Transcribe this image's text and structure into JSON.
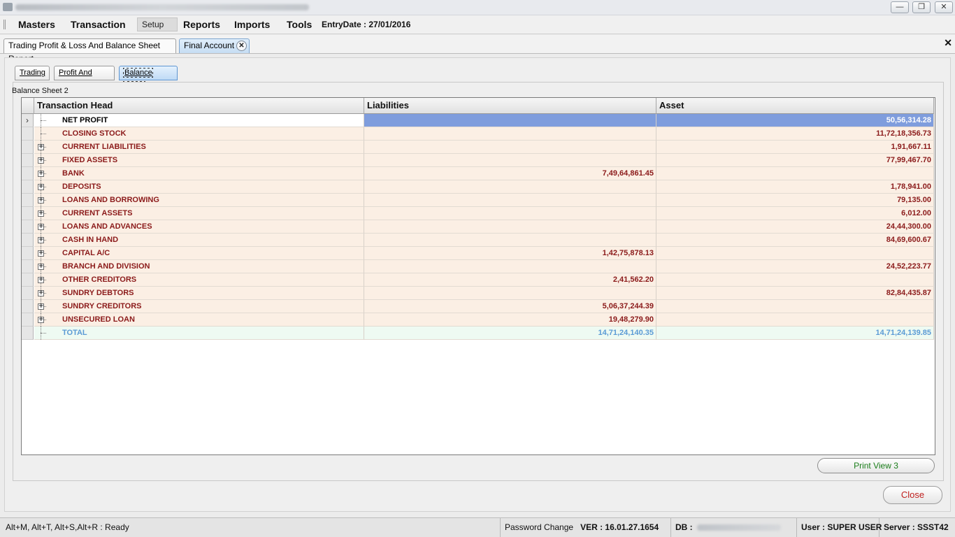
{
  "menu": {
    "items": [
      "Masters",
      "Transaction",
      "Setup",
      "Reports",
      "Imports",
      "Tools"
    ],
    "entry_date": "EntryDate : 27/01/2016"
  },
  "window_buttons": {
    "minimize": "—",
    "restore": "❐",
    "close": "✕"
  },
  "doc_tabs": {
    "tab1": "Trading Profit & Loss And Balance Sheet  Report",
    "tab2": "Final Account",
    "close_glyph": "✕"
  },
  "sub_tabs": [
    "Trading",
    "Profit And Loss",
    "Balance Sheet"
  ],
  "group_label": "Balance Sheet 2",
  "grid": {
    "columns": [
      "Transaction Head",
      "Liabilities",
      "Asset"
    ],
    "rows": [
      {
        "head": "NET PROFIT",
        "liabilities": "",
        "asset": "50,56,314.28"
      },
      {
        "head": "CLOSING STOCK",
        "liabilities": "",
        "asset": "11,72,18,356.73"
      },
      {
        "head": "CURRENT LIABILITIES",
        "liabilities": "",
        "asset": "1,91,667.11"
      },
      {
        "head": "FIXED ASSETS",
        "liabilities": "",
        "asset": "77,99,467.70"
      },
      {
        "head": "BANK",
        "liabilities": "7,49,64,861.45",
        "asset": ""
      },
      {
        "head": "DEPOSITS",
        "liabilities": "",
        "asset": "1,78,941.00"
      },
      {
        "head": "LOANS AND BORROWING",
        "liabilities": "",
        "asset": "79,135.00"
      },
      {
        "head": "CURRENT ASSETS",
        "liabilities": "",
        "asset": "6,012.00"
      },
      {
        "head": "LOANS AND ADVANCES",
        "liabilities": "",
        "asset": "24,44,300.00"
      },
      {
        "head": "CASH IN HAND",
        "liabilities": "",
        "asset": "84,69,600.67"
      },
      {
        "head": "CAPITAL A/C",
        "liabilities": "1,42,75,878.13",
        "asset": ""
      },
      {
        "head": "BRANCH AND DIVISION",
        "liabilities": "",
        "asset": "24,52,223.77"
      },
      {
        "head": "OTHER CREDITORS",
        "liabilities": "2,41,562.20",
        "asset": ""
      },
      {
        "head": "SUNDRY DEBTORS",
        "liabilities": "",
        "asset": "82,84,435.87"
      },
      {
        "head": "SUNDRY CREDITORS",
        "liabilities": "5,06,37,244.39",
        "asset": ""
      },
      {
        "head": "UNSECURED LOAN",
        "liabilities": "19,48,279.90",
        "asset": ""
      },
      {
        "head": "TOTAL",
        "liabilities": "14,71,24,140.35",
        "asset": "14,71,24,139.85"
      }
    ]
  },
  "buttons": {
    "print_view": "Print View 3",
    "close": "Close"
  },
  "status": {
    "shortcuts": "Alt+M, Alt+T, Alt+S,Alt+R   : Ready",
    "password": "Password Change",
    "version": "VER : 16.01.27.1654",
    "db": "DB :",
    "user": "User : SUPER USER",
    "server": "Server : SSST42"
  },
  "colors": {
    "row_text": "#8b1a1a",
    "total_text": "#5b9bd5",
    "selection": "#7f9ddd",
    "print_text": "#1a7d1a",
    "close_text": "#c0201f"
  }
}
